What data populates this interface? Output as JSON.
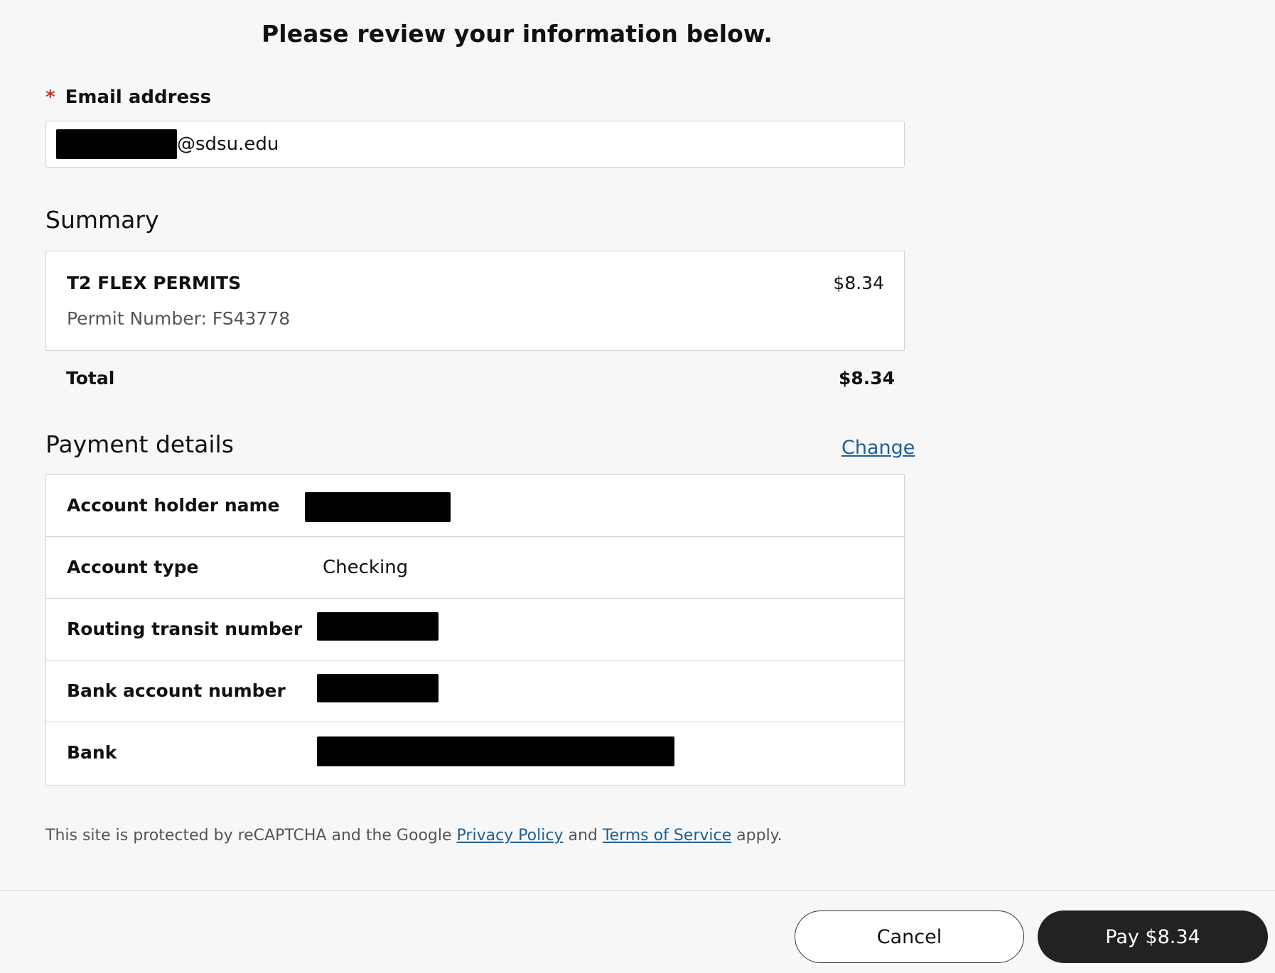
{
  "header": {
    "title": "Please review your information below."
  },
  "email": {
    "required_marker": "*",
    "label": "Email address",
    "value_suffix": "@sdsu.edu"
  },
  "summary": {
    "title": "Summary",
    "items": [
      {
        "name": "T2 FLEX PERMITS",
        "price": "$8.34",
        "detail": "Permit Number: FS43778"
      }
    ],
    "total_label": "Total",
    "total_value": "$8.34"
  },
  "payment": {
    "title": "Payment details",
    "change_label": "Change",
    "rows": [
      {
        "label": "Account holder name",
        "value": ""
      },
      {
        "label": "Account type",
        "value": "Checking"
      },
      {
        "label": "Routing transit number",
        "value": ""
      },
      {
        "label": "Bank account number",
        "value": ""
      },
      {
        "label": "Bank",
        "value": ""
      }
    ]
  },
  "recaptcha": {
    "prefix": "This site is protected by reCAPTCHA and the Google",
    "privacy_link": "Privacy Policy",
    "and": "and",
    "terms_link": "Terms of Service",
    "suffix": "apply."
  },
  "footer": {
    "cancel_label": "Cancel",
    "pay_label": "Pay $8.34"
  },
  "colors": {
    "background": "#f7f7f7",
    "required": "#c0392b",
    "link": "#1f5f95",
    "primary_button": "#222222"
  }
}
